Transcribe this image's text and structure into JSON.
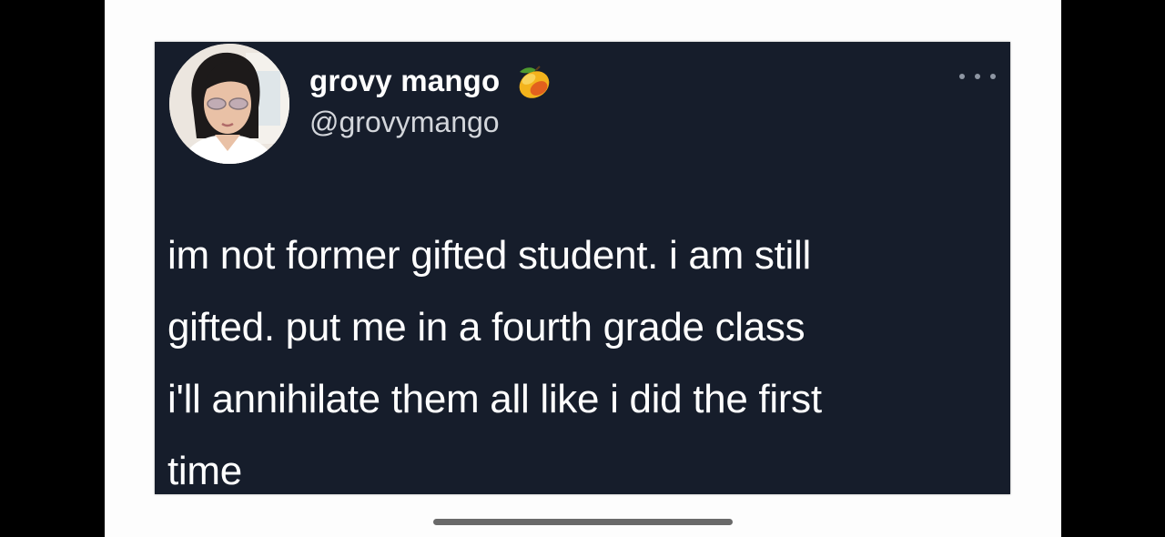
{
  "tweet": {
    "display_name": "grovy mango",
    "handle": "@grovymango",
    "verified_emoji_icon": "mango-emoji-icon",
    "more_icon": "more-options-icon",
    "text_lines": [
      "im not former gifted student. i am still",
      "gifted. put me in a fourth grade class",
      "i'll annihilate them all like i did the first",
      "time"
    ]
  },
  "colors": {
    "card_background": "#161d2b",
    "page_background": "#fdfdfd",
    "outer_background": "#000000",
    "name_text": "#ffffff",
    "handle_text": "#d3d6db"
  }
}
